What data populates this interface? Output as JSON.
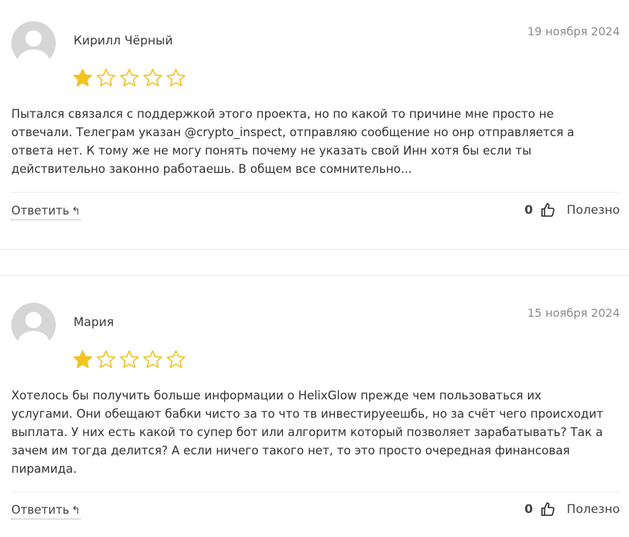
{
  "colors": {
    "star_filled": "#f2c321",
    "star_empty_stroke": "#f2c321",
    "avatar_bg": "#d6d6d6",
    "date_text": "#8a8a8a"
  },
  "reviews": [
    {
      "author": "Кирилл Чёрный",
      "date": "19 ноября 2024",
      "rating": 1,
      "rating_max": 5,
      "lines": [
        "Пытался связался с поддержкой этого проекта, но по какой то причине мне просто не",
        "отвечали. Телеграм указан @crypto_inspect, отправляю сообщение но онр отправляется а",
        "ответа нет. К тому же не могу понять почему не указать свой Инн хотя бы если ты",
        "действительно законно работаешь. В общем все сомнительно..."
      ],
      "reply_label": "Ответить",
      "reply_icon": "↰",
      "helpful_count": "0",
      "helpful_label": "Полезно"
    },
    {
      "author": "Мария",
      "date": "15 ноября 2024",
      "rating": 1,
      "rating_max": 5,
      "lines": [
        "Хотелось бы получить больше информации о HelixGlow прежде чем пользоваться их",
        "услугами. Они обещают бабки чисто за то что тв инвестируеешбь, но за счёт чего происходит",
        "выплата. У них есть какой то супер бот или алгоритм который позволяет зарабатывать? Так а",
        "зачем им тогда делится? А если ничего такого нет, то это просто очередная финансовая",
        "пирамида."
      ],
      "reply_label": "Ответить",
      "reply_icon": "↰",
      "helpful_count": "0",
      "helpful_label": "Полезно"
    }
  ],
  "icons": {
    "avatar": "user-avatar-placeholder",
    "star": "star-icon",
    "thumb": "thumbs-up-icon",
    "reply": "reply-arrow-icon"
  }
}
